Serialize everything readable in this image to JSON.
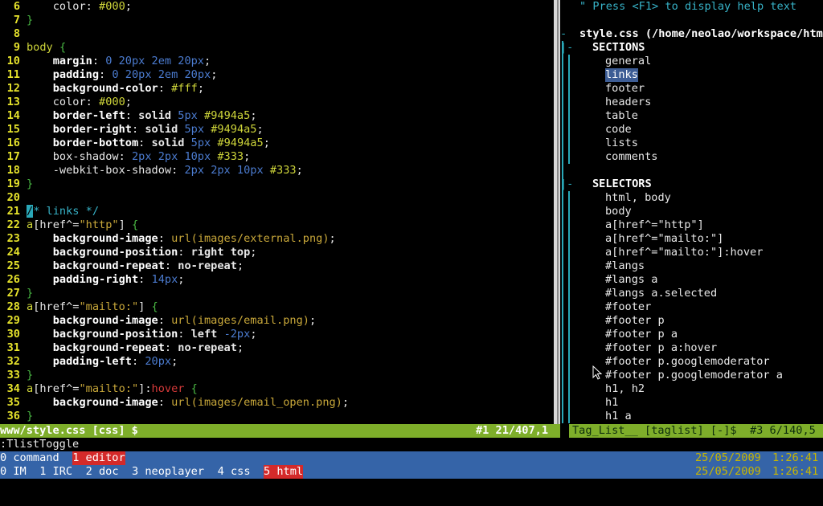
{
  "editor": {
    "lines": [
      {
        "n": "6",
        "parts": [
          [
            "    ",
            "code"
          ],
          [
            "color",
            "t-prop"
          ],
          [
            ": ",
            "code"
          ],
          [
            "#000",
            "t-hex"
          ],
          [
            ";",
            "code"
          ]
        ]
      },
      {
        "n": "7",
        "parts": [
          [
            "}",
            "t-brace"
          ]
        ]
      },
      {
        "n": "8",
        "parts": []
      },
      {
        "n": "9",
        "parts": [
          [
            "body",
            "t-sel"
          ],
          [
            " ",
            "code"
          ],
          [
            "{",
            "t-brace"
          ]
        ]
      },
      {
        "n": "10",
        "parts": [
          [
            "    ",
            "code"
          ],
          [
            "margin",
            "t-prop-b"
          ],
          [
            ": ",
            "code"
          ],
          [
            "0 20px 2em 20px",
            "t-num"
          ],
          [
            ";",
            "code"
          ]
        ]
      },
      {
        "n": "11",
        "parts": [
          [
            "    ",
            "code"
          ],
          [
            "padding",
            "t-prop-b"
          ],
          [
            ": ",
            "code"
          ],
          [
            "0 20px 2em 20px",
            "t-num"
          ],
          [
            ";",
            "code"
          ]
        ]
      },
      {
        "n": "12",
        "parts": [
          [
            "    ",
            "code"
          ],
          [
            "background-color",
            "t-prop-b"
          ],
          [
            ": ",
            "code"
          ],
          [
            "#fff",
            "t-hex"
          ],
          [
            ";",
            "code"
          ]
        ]
      },
      {
        "n": "13",
        "parts": [
          [
            "    ",
            "code"
          ],
          [
            "color",
            "t-prop"
          ],
          [
            ": ",
            "code"
          ],
          [
            "#000",
            "t-hex"
          ],
          [
            ";",
            "code"
          ]
        ]
      },
      {
        "n": "14",
        "parts": [
          [
            "    ",
            "code"
          ],
          [
            "border-left",
            "t-prop-b"
          ],
          [
            ": ",
            "code"
          ],
          [
            "solid",
            "t-kw"
          ],
          [
            " ",
            "code"
          ],
          [
            "5px",
            "t-num"
          ],
          [
            " ",
            "code"
          ],
          [
            "#9494a5",
            "t-hex"
          ],
          [
            ";",
            "code"
          ]
        ]
      },
      {
        "n": "15",
        "parts": [
          [
            "    ",
            "code"
          ],
          [
            "border-right",
            "t-prop-b"
          ],
          [
            ": ",
            "code"
          ],
          [
            "solid",
            "t-kw"
          ],
          [
            " ",
            "code"
          ],
          [
            "5px",
            "t-num"
          ],
          [
            " ",
            "code"
          ],
          [
            "#9494a5",
            "t-hex"
          ],
          [
            ";",
            "code"
          ]
        ]
      },
      {
        "n": "16",
        "parts": [
          [
            "    ",
            "code"
          ],
          [
            "border-bottom",
            "t-prop-b"
          ],
          [
            ": ",
            "code"
          ],
          [
            "solid",
            "t-kw"
          ],
          [
            " ",
            "code"
          ],
          [
            "5px",
            "t-num"
          ],
          [
            " ",
            "code"
          ],
          [
            "#9494a5",
            "t-hex"
          ],
          [
            ";",
            "code"
          ]
        ]
      },
      {
        "n": "17",
        "parts": [
          [
            "    ",
            "code"
          ],
          [
            "box-shadow",
            "t-prop"
          ],
          [
            ": ",
            "code"
          ],
          [
            "2px 2px 10px",
            "t-num"
          ],
          [
            " ",
            "code"
          ],
          [
            "#333",
            "t-hex"
          ],
          [
            ";",
            "code"
          ]
        ]
      },
      {
        "n": "18",
        "parts": [
          [
            "    ",
            "code"
          ],
          [
            "-webkit-box-shadow",
            "t-prop"
          ],
          [
            ": ",
            "code"
          ],
          [
            "2px 2px 10px",
            "t-num"
          ],
          [
            " ",
            "code"
          ],
          [
            "#333",
            "t-hex"
          ],
          [
            ";",
            "code"
          ]
        ]
      },
      {
        "n": "19",
        "parts": [
          [
            "}",
            "t-brace"
          ]
        ]
      },
      {
        "n": "20",
        "parts": []
      },
      {
        "n": "21",
        "parts": [
          [
            "/",
            "cursor"
          ],
          [
            "* links */",
            "t-comment"
          ]
        ]
      },
      {
        "n": "22",
        "parts": [
          [
            "a",
            "t-sel"
          ],
          [
            "[",
            "code"
          ],
          [
            "href",
            "code"
          ],
          [
            "^=",
            "code"
          ],
          [
            "\"http\"",
            "t-str"
          ],
          [
            "] ",
            "code"
          ],
          [
            "{",
            "t-brace"
          ]
        ]
      },
      {
        "n": "23",
        "parts": [
          [
            "    ",
            "code"
          ],
          [
            "background-image",
            "t-prop-b"
          ],
          [
            ": ",
            "code"
          ],
          [
            "url(images/external.png)",
            "t-str"
          ],
          [
            ";",
            "code"
          ]
        ]
      },
      {
        "n": "24",
        "parts": [
          [
            "    ",
            "code"
          ],
          [
            "background-position",
            "t-prop-b"
          ],
          [
            ": ",
            "code"
          ],
          [
            "right top",
            "t-kw"
          ],
          [
            ";",
            "code"
          ]
        ]
      },
      {
        "n": "25",
        "parts": [
          [
            "    ",
            "code"
          ],
          [
            "background-repeat",
            "t-prop-b"
          ],
          [
            ": ",
            "code"
          ],
          [
            "no-repeat",
            "t-kw"
          ],
          [
            ";",
            "code"
          ]
        ]
      },
      {
        "n": "26",
        "parts": [
          [
            "    ",
            "code"
          ],
          [
            "padding-right",
            "t-prop-b"
          ],
          [
            ": ",
            "code"
          ],
          [
            "14px",
            "t-num"
          ],
          [
            ";",
            "code"
          ]
        ]
      },
      {
        "n": "27",
        "parts": [
          [
            "}",
            "t-brace"
          ]
        ]
      },
      {
        "n": "28",
        "parts": [
          [
            "a",
            "t-sel"
          ],
          [
            "[",
            "code"
          ],
          [
            "href",
            "code"
          ],
          [
            "^=",
            "code"
          ],
          [
            "\"mailto:\"",
            "t-str"
          ],
          [
            "] ",
            "code"
          ],
          [
            "{",
            "t-brace"
          ]
        ]
      },
      {
        "n": "29",
        "parts": [
          [
            "    ",
            "code"
          ],
          [
            "background-image",
            "t-prop-b"
          ],
          [
            ": ",
            "code"
          ],
          [
            "url(images/email.png)",
            "t-str"
          ],
          [
            ";",
            "code"
          ]
        ]
      },
      {
        "n": "30",
        "parts": [
          [
            "    ",
            "code"
          ],
          [
            "background-position",
            "t-prop-b"
          ],
          [
            ": ",
            "code"
          ],
          [
            "left",
            "t-kw"
          ],
          [
            " ",
            "code"
          ],
          [
            "-2px",
            "t-num"
          ],
          [
            ";",
            "code"
          ]
        ]
      },
      {
        "n": "31",
        "parts": [
          [
            "    ",
            "code"
          ],
          [
            "background-repeat",
            "t-prop-b"
          ],
          [
            ": ",
            "code"
          ],
          [
            "no-repeat",
            "t-kw"
          ],
          [
            ";",
            "code"
          ]
        ]
      },
      {
        "n": "32",
        "parts": [
          [
            "    ",
            "code"
          ],
          [
            "padding-left",
            "t-prop-b"
          ],
          [
            ": ",
            "code"
          ],
          [
            "20px",
            "t-num"
          ],
          [
            ";",
            "code"
          ]
        ]
      },
      {
        "n": "33",
        "parts": [
          [
            "}",
            "t-brace"
          ]
        ]
      },
      {
        "n": "34",
        "parts": [
          [
            "a",
            "t-sel"
          ],
          [
            "[",
            "code"
          ],
          [
            "href",
            "code"
          ],
          [
            "^=",
            "code"
          ],
          [
            "\"mailto:\"",
            "t-str"
          ],
          [
            "]:",
            "code"
          ],
          [
            "hover",
            "t-pseudo"
          ],
          [
            " ",
            "code"
          ],
          [
            "{",
            "t-brace"
          ]
        ]
      },
      {
        "n": "35",
        "parts": [
          [
            "    ",
            "code"
          ],
          [
            "background-image",
            "t-prop-b"
          ],
          [
            ": ",
            "code"
          ],
          [
            "url(images/email_open.png)",
            "t-str"
          ],
          [
            ";",
            "code"
          ]
        ]
      },
      {
        "n": "36",
        "parts": [
          [
            "}",
            "t-brace"
          ]
        ]
      }
    ]
  },
  "taglist": {
    "help": "\" Press <F1> to display help text",
    "file": "style.css (/home/neolao/workspace/htm",
    "sections_header": "SECTIONS",
    "sections": [
      "general",
      "links",
      "footer",
      "headers",
      "table",
      "code",
      "lists",
      "comments"
    ],
    "selected_section": "links",
    "selectors_header": "SELECTORS",
    "selectors": [
      "html, body",
      "body",
      "a[href^=\"http\"]",
      "a[href^=\"mailto:\"]",
      "a[href^=\"mailto:\"]:hover",
      "#langs",
      "#langs a",
      "#langs a.selected",
      "#footer",
      "#footer p",
      "#footer p a",
      "#footer p a:hover",
      "#footer p.googlemoderator",
      "#footer p.googlemoderator a",
      "h1, h2",
      "h1",
      "h1 a"
    ]
  },
  "status": {
    "left_file": "www/style.css [css] $",
    "left_pos": "#1 21/407,1",
    "right_text": "Tag_List__ [taglist] [-]$  #3 6/140,5"
  },
  "cmdline": ":TlistToggle",
  "screen": {
    "row1": [
      {
        "label": "0 command",
        "active": false
      },
      {
        "label": "1 editor",
        "active": true
      }
    ],
    "row2": [
      {
        "label": "0 IM",
        "active": false
      },
      {
        "label": "1 IRC",
        "active": false
      },
      {
        "label": "2 doc",
        "active": false
      },
      {
        "label": "3 neoplayer",
        "active": false
      },
      {
        "label": "4 css",
        "active": false
      },
      {
        "label": "5 html",
        "active": true
      }
    ],
    "date": "25/05/2009",
    "time": "1:26:41"
  },
  "colors": {
    "status_bar": "#7eae2a",
    "screen_bar": "#3564a8",
    "active_window": "#d42a2a"
  }
}
